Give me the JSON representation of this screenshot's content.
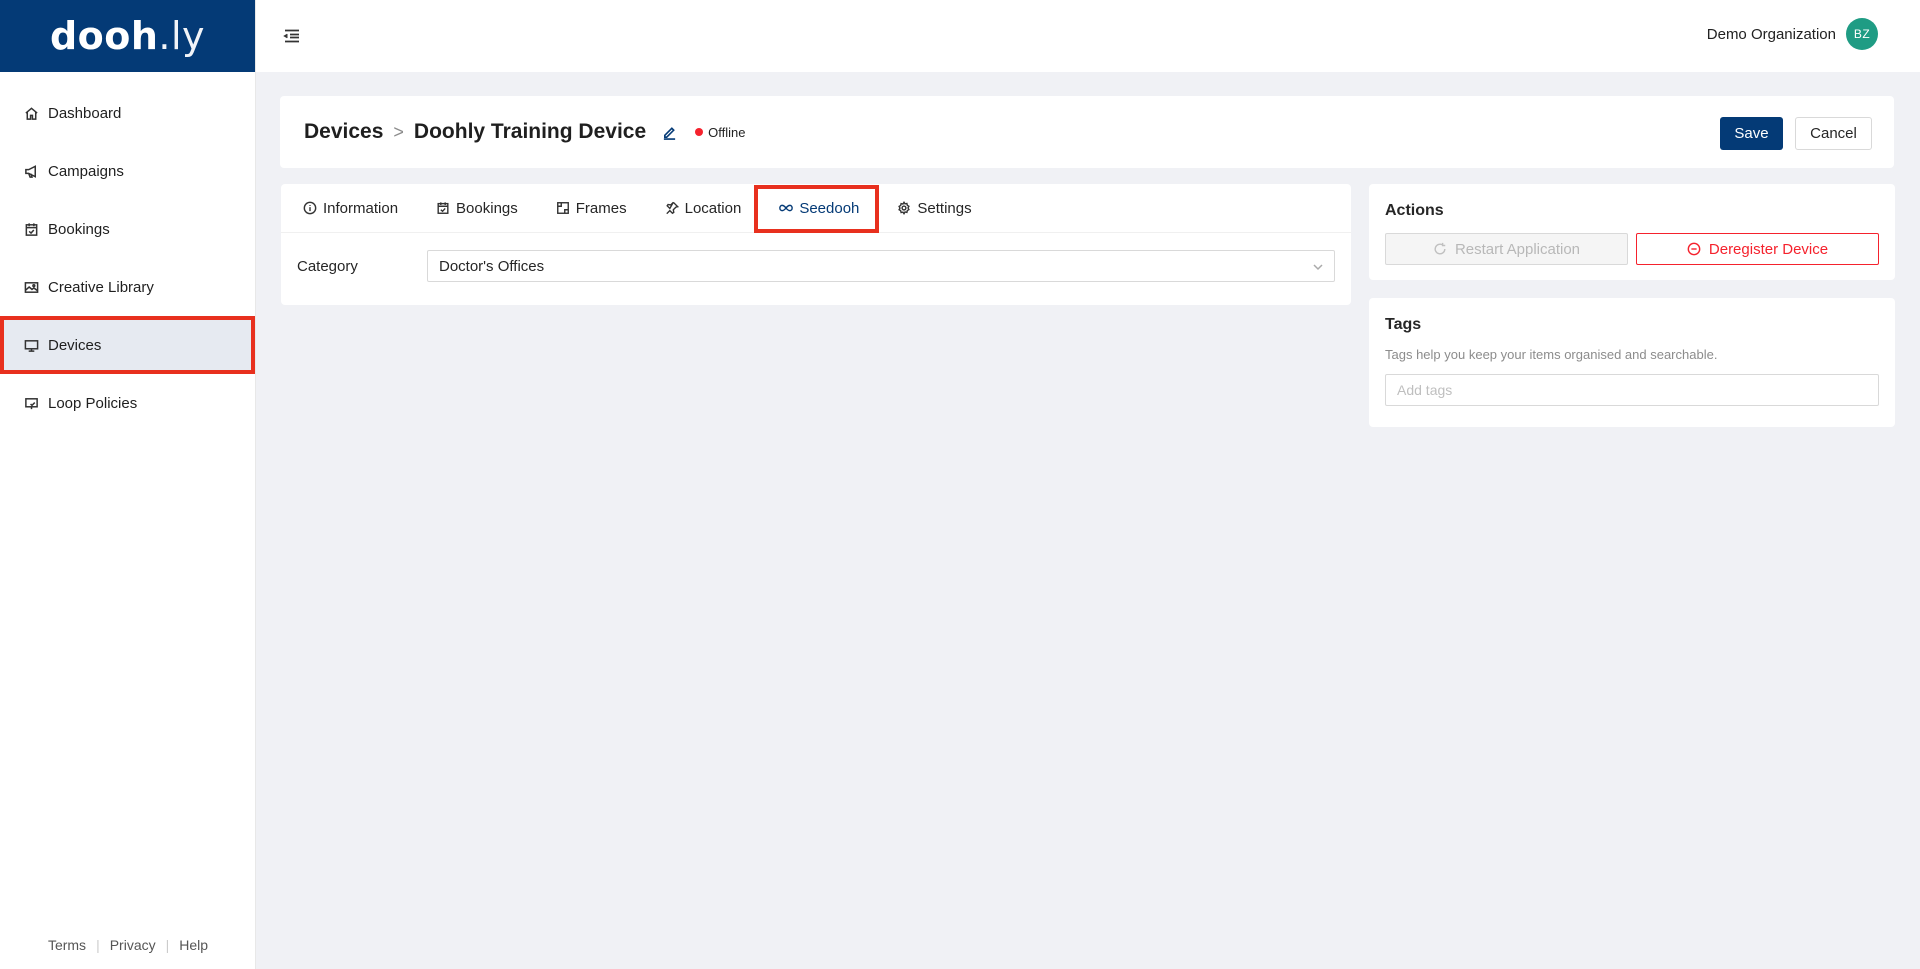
{
  "brand": {
    "logo_part1": "dooh",
    "logo_dot": ".",
    "logo_part2": "ly"
  },
  "sidebar": {
    "items": [
      {
        "label": "Dashboard",
        "icon": "home-icon"
      },
      {
        "label": "Campaigns",
        "icon": "megaphone-icon"
      },
      {
        "label": "Bookings",
        "icon": "calendar-check-icon"
      },
      {
        "label": "Creative Library",
        "icon": "image-icon"
      },
      {
        "label": "Devices",
        "icon": "monitor-icon",
        "active": true
      },
      {
        "label": "Loop Policies",
        "icon": "loop-policy-icon"
      }
    ],
    "footer": [
      "Terms",
      "Privacy",
      "Help"
    ]
  },
  "header": {
    "org_name": "Demo Organization",
    "avatar_initials": "BZ",
    "avatar_color": "#1f9c84"
  },
  "page": {
    "breadcrumb_root": "Devices",
    "breadcrumb_separator": ">",
    "title": "Doohly Training Device",
    "status": "Offline",
    "status_color": "#f5222d",
    "save_label": "Save",
    "cancel_label": "Cancel"
  },
  "tabs": [
    {
      "label": "Information",
      "icon": "info-circle-icon"
    },
    {
      "label": "Bookings",
      "icon": "calendar-check-icon"
    },
    {
      "label": "Frames",
      "icon": "frame-icon"
    },
    {
      "label": "Location",
      "icon": "pin-icon"
    },
    {
      "label": "Seedooh",
      "icon": "infinity-icon",
      "active": true
    },
    {
      "label": "Settings",
      "icon": "gear-icon"
    }
  ],
  "seedooh": {
    "category_label": "Category",
    "category_value": "Doctor's Offices"
  },
  "actions": {
    "title": "Actions",
    "restart_label": "Restart Application",
    "deregister_label": "Deregister Device"
  },
  "tags": {
    "title": "Tags",
    "help": "Tags help you keep your items organised and searchable.",
    "placeholder": "Add tags"
  },
  "colors": {
    "brand": "#043a76",
    "highlight": "#e8301e",
    "danger": "#f5222d",
    "background": "#f0f1f5"
  }
}
